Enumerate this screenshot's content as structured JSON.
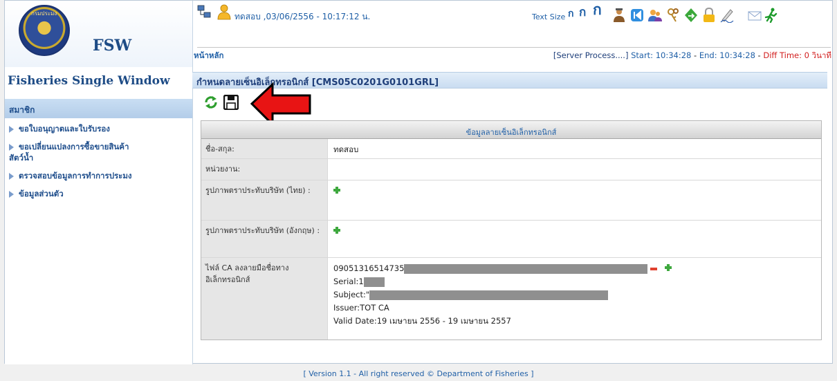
{
  "sidebar": {
    "logo_seal_text": "กรมประมง",
    "logo_text": "FSW",
    "app_name": "Fisheries Single Window",
    "section_title": "สมาชิก",
    "items": [
      {
        "label": "ขอใบอนุญาตและใบรับรอง"
      },
      {
        "label": "ขอเปลี่ยนแปลงการซื้อขายสินค้า",
        "label_cont": "สัตว์น้ำ"
      },
      {
        "label": "ตรวจสอบข้อมูลการทำการประมง"
      },
      {
        "label": "ข้อมูลส่วนตัว"
      }
    ]
  },
  "header": {
    "user_info": "ทดสอบ ,03/06/2556 - 10:17:12 น.",
    "text_size_label": "Text Size",
    "text_size_glyph": "ก",
    "home_link": "หน้าหลัก",
    "server_process": "[Server Process....]",
    "start_label": "Start:",
    "start_time": "10:34:28",
    "end_label": "End:",
    "end_time": "10:34:28",
    "diff_label": "Diff Time: 0 วินาที"
  },
  "page": {
    "title": "กำหนดลายเซ็นอิเล็กทรอนิกส์ [CMS05C0201G0101GRL]"
  },
  "form": {
    "section_title": "ข้อมูลลายเซ็นอิเล็กทรอนิกส์",
    "name_label": "ชื่อ-สกุล:",
    "name_value": "ทดสอบ",
    "agency_label": "หน่วยงาน:",
    "stamp_th_label": "รูปภาพตราประทับบริษัท (ไทย) :",
    "stamp_en_label": "รูปภาพตราประทับบริษัท (อังกฤษ) :",
    "ca_label": "ไฟล์ CA ลงลายมือชื่อทางอิเล็กทรอนิกส์",
    "ca_id": "09051316514735",
    "serial_label": "Serial:",
    "serial_prefix": "1",
    "subject_label": "Subject:\"",
    "issuer": "Issuer:TOT CA",
    "valid_date": "Valid Date:19 เมษายน 2556 - 19 เมษายน 2557"
  },
  "footer": {
    "text": "[ Version 1.1 - All right reserved © Department of Fisheries ]"
  },
  "colors": {
    "brand_blue": "#1f4e8c",
    "link_blue": "#1f5fa6",
    "alert_red": "#d21f1f",
    "add_green": "#3ea83e"
  }
}
